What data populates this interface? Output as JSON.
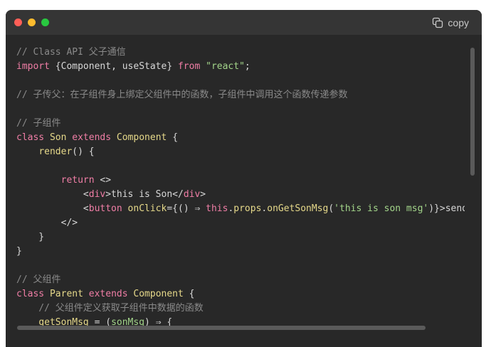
{
  "window": {
    "copy_label": "copy",
    "icons": {
      "copy": "copy-icon"
    },
    "colors": {
      "background": "#282828",
      "titlebar": "#353535",
      "comment": "#8a8a8a",
      "keyword": "#f07ea6",
      "function": "#e6d98a",
      "string": "#a3d58a"
    }
  },
  "code": {
    "lines": [
      [
        {
          "t": "// Class API 父子通信",
          "c": "c"
        }
      ],
      [
        {
          "t": "import ",
          "c": "k"
        },
        {
          "t": "{Component, useState} ",
          "c": "p"
        },
        {
          "t": "from ",
          "c": "k"
        },
        {
          "t": "\"react\"",
          "c": "s"
        },
        {
          "t": ";",
          "c": "p"
        }
      ],
      [],
      [
        {
          "t": "// 子传父：在子组件身上绑定父组件中的函数，子组件中调用这个函数传递参数",
          "c": "c"
        }
      ],
      [],
      [
        {
          "t": "// 子组件",
          "c": "c"
        }
      ],
      [
        {
          "t": "class ",
          "c": "k"
        },
        {
          "t": "Son ",
          "c": "f"
        },
        {
          "t": "extends ",
          "c": "k"
        },
        {
          "t": "Component ",
          "c": "f"
        },
        {
          "t": "{",
          "c": "p"
        }
      ],
      [
        {
          "t": "    ",
          "c": "p"
        },
        {
          "t": "render",
          "c": "f"
        },
        {
          "t": "() {",
          "c": "p"
        }
      ],
      [],
      [
        {
          "t": "        ",
          "c": "p"
        },
        {
          "t": "return ",
          "c": "k"
        },
        {
          "t": "<>",
          "c": "p"
        }
      ],
      [
        {
          "t": "            <",
          "c": "p"
        },
        {
          "t": "div",
          "c": "k"
        },
        {
          "t": ">this is Son</",
          "c": "p"
        },
        {
          "t": "div",
          "c": "k"
        },
        {
          "t": ">",
          "c": "p"
        }
      ],
      [
        {
          "t": "            <",
          "c": "p"
        },
        {
          "t": "button ",
          "c": "k"
        },
        {
          "t": "onClick",
          "c": "f"
        },
        {
          "t": "={() ⇒ ",
          "c": "p"
        },
        {
          "t": "this",
          "c": "k"
        },
        {
          "t": ".",
          "c": "p"
        },
        {
          "t": "props",
          "c": "f"
        },
        {
          "t": ".",
          "c": "p"
        },
        {
          "t": "onGetSonMsg",
          "c": "f"
        },
        {
          "t": "(",
          "c": "p"
        },
        {
          "t": "'this is son msg'",
          "c": "s"
        },
        {
          "t": ")}>sendMsgToParent<",
          "c": "p"
        }
      ],
      [
        {
          "t": "        </>",
          "c": "p"
        }
      ],
      [
        {
          "t": "    }",
          "c": "p"
        }
      ],
      [
        {
          "t": "}",
          "c": "p"
        }
      ],
      [],
      [
        {
          "t": "// 父组件",
          "c": "c"
        }
      ],
      [
        {
          "t": "class ",
          "c": "k"
        },
        {
          "t": "Parent ",
          "c": "f"
        },
        {
          "t": "extends ",
          "c": "k"
        },
        {
          "t": "Component ",
          "c": "f"
        },
        {
          "t": "{",
          "c": "p"
        }
      ],
      [
        {
          "t": "    // 父组件定义获取子组件中数据的函数",
          "c": "c"
        }
      ],
      [
        {
          "t": "    ",
          "c": "p"
        },
        {
          "t": "getSonMsg ",
          "c": "f"
        },
        {
          "t": "= (",
          "c": "p"
        },
        {
          "t": "sonMsg",
          "c": "s"
        },
        {
          "t": ") ⇒ {",
          "c": "p"
        }
      ]
    ]
  }
}
